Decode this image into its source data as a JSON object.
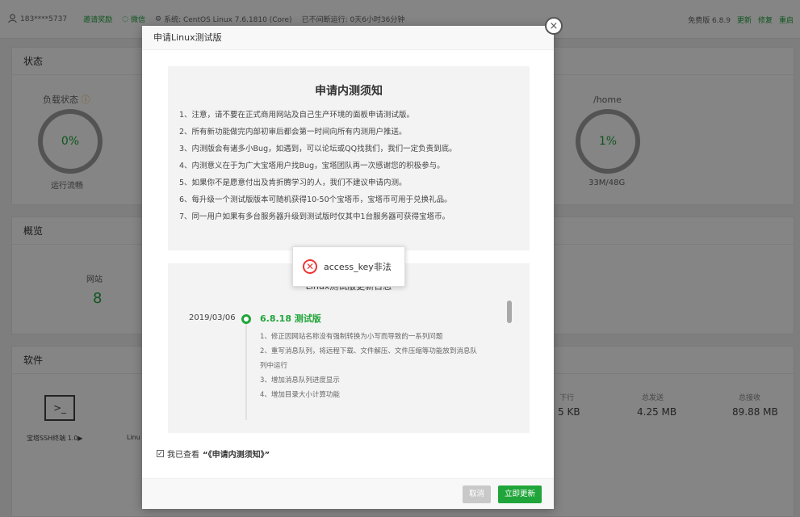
{
  "topbar": {
    "user": "183****5737",
    "invite": "邀请奖励",
    "wechat": "微信",
    "system": "系统: CentOS Linux 7.6.1810 (Core)",
    "uptime": "已不间断运行: 0天6小时36分钟",
    "version": "免费版 6.8.9",
    "update": "更新",
    "repair": "修复",
    "restart": "重启"
  },
  "status": {
    "title": "状态",
    "load_label": "负载状态",
    "load_value": "0%",
    "load_text": "运行流畅",
    "disk_label": "/home",
    "disk_value": "1%",
    "disk_text": "33M/48G"
  },
  "overview": {
    "title": "概览",
    "site_label": "网站",
    "site_value": "8"
  },
  "software": {
    "title": "软件",
    "item1": "宝塔SSH终端 1.0▶",
    "item2": "Linu"
  },
  "traffic": {
    "down_label": "下行",
    "down_value": "5 KB",
    "sent_label": "总发送",
    "sent_value": "4.25 MB",
    "recv_label": "总接收",
    "recv_value": "89.88 MB"
  },
  "dialog": {
    "title": "申请Linux测试版",
    "close": "×",
    "notice_title": "申请内测须知",
    "notice_items": [
      "1、注意，请不要在正式商用网站及自己生产环境的面板申请测试版。",
      "2、所有新功能做完内部初审后都会第一时间向所有内测用户推送。",
      "3、内测版会有诸多小Bug，如遇到，可以论坛或QQ找我们，我们一定负责到底。",
      "4、内测意义在于为广大宝塔用户找Bug，宝塔团队再一次感谢您的积极参与。",
      "5、如果你不是愿意付出及肯折腾学习的人，我们不建议申请内测。",
      "6、每升级一个测试版版本可随机获得10-50个宝塔币，宝塔币可用于兑换礼品。",
      "7、同一用户如果有多台服务器升级到测试版时仅其中1台服务器可获得宝塔币。"
    ],
    "changelog_heading": "Linux测试版更新日志",
    "changelog_date": "2019/03/06",
    "changelog_version": "6.8.18 测试版",
    "changelog_items": [
      "1、修正因网站名称没有强制转换为小写而导致的一系列问题",
      "2、重写消息队列，将远程下载、文件解压、文件压缩等功能放到消息队",
      "列中运行",
      "3、增加消息队列进度显示",
      "4、增加目录大小计算功能"
    ],
    "agree_prefix": "我已查看",
    "agree_link": "“《申请内测须知》”",
    "cancel_label": "取消",
    "update_label": "立即更新"
  },
  "toast": {
    "message": "access_key非法"
  }
}
